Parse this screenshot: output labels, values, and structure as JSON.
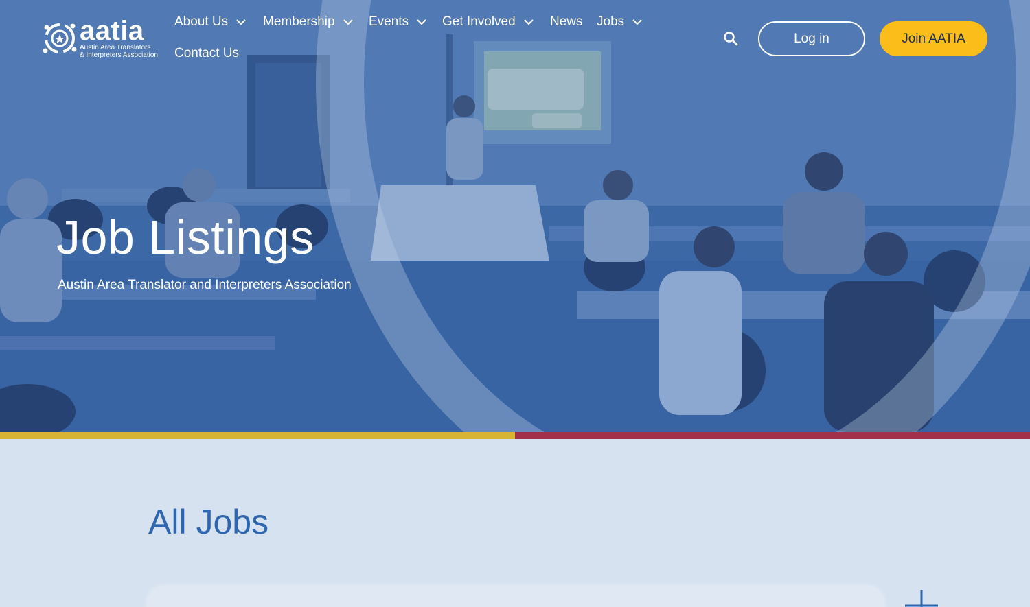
{
  "brand": {
    "name": "aatia",
    "subtitle_line1": "Austin Area Translators",
    "subtitle_line2": "& Interpreters Association"
  },
  "nav": {
    "items": [
      {
        "label": "About Us",
        "has_dropdown": true
      },
      {
        "label": "Membership",
        "has_dropdown": true
      },
      {
        "label": "Events",
        "has_dropdown": true
      },
      {
        "label": "Get Involved",
        "has_dropdown": true
      },
      {
        "label": "News",
        "has_dropdown": false
      },
      {
        "label": "Jobs",
        "has_dropdown": true
      },
      {
        "label": "Contact Us",
        "has_dropdown": false
      }
    ],
    "login_label": "Log in",
    "join_label": "Join AATIA"
  },
  "hero": {
    "title": "Job Listings",
    "subtitle": "Austin Area Translator and Interpreters Association"
  },
  "content": {
    "section_title": "All Jobs"
  },
  "colors": {
    "hero_blue": "#4a74ae",
    "join_yellow": "#fbbd1a",
    "stripe_gold": "#d8b434",
    "stripe_red": "#a3304b",
    "heading_blue": "#2e67b0",
    "page_bg": "#d6e2f0"
  },
  "icons": {
    "search": "search-icon",
    "dropdown": "chevron-down-icon",
    "expand": "plus-icon"
  }
}
